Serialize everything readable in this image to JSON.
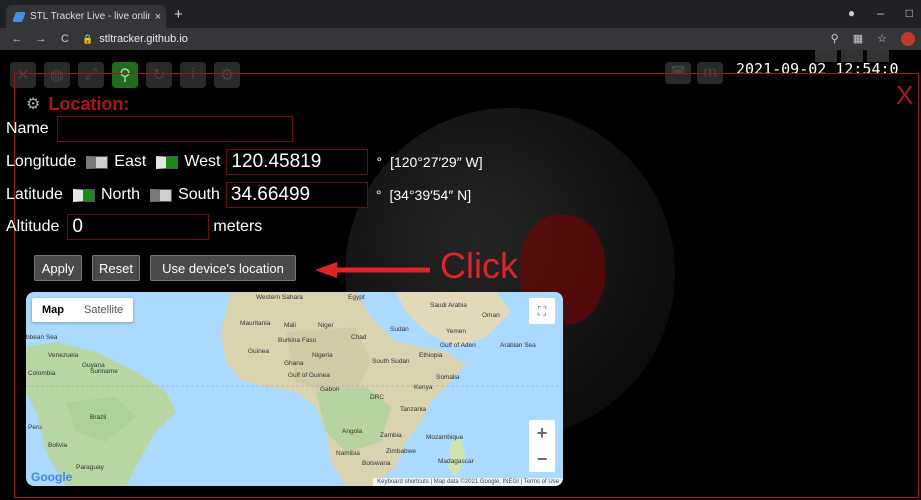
{
  "browser": {
    "tab_title": "STL Tracker Live - live online sate",
    "tab_close": "×",
    "new_tab": "+",
    "url": "stltracker.github.io",
    "minimize": "–",
    "maximize": "□"
  },
  "app": {
    "datetime": "2021-09-02 12:54:0",
    "close_label": "X",
    "toolbar_icons": [
      "satellite-icon",
      "globe-icon",
      "expand-icon",
      "location-icon",
      "refresh-icon",
      "info-icon",
      "settings-icon"
    ],
    "active_tool": "location-icon"
  },
  "location": {
    "title": "Location:",
    "name_label": "Name",
    "name_value": "",
    "longitude_label": "Longitude",
    "east_label": "East",
    "west_label": "West",
    "longitude_value": "120.45819",
    "longitude_degree": "°",
    "longitude_dms": "[120°27′29″ W]",
    "latitude_label": "Latitude",
    "north_label": "North",
    "south_label": "South",
    "latitude_value": "34.66499",
    "latitude_degree": "°",
    "latitude_dms": "[34°39′54″ N]",
    "altitude_label": "Altitude",
    "altitude_value": "0",
    "altitude_unit": "meters",
    "apply_label": "Apply",
    "reset_label": "Reset",
    "device_label": "Use device's location"
  },
  "annotation": {
    "click_text": "Click",
    "color": "#e02424"
  },
  "map": {
    "type_map": "Map",
    "type_satellite": "Satellite",
    "zoom_in": "+",
    "zoom_out": "−",
    "logo": "Google",
    "attribution": "Keyboard shortcuts | Map data ©2021 Google, INEGI | Terms of Use",
    "labels": {
      "western_sahara": "Western Sahara",
      "mauritania": "Mauritania",
      "mali": "Mali",
      "niger": "Niger",
      "chad": "Chad",
      "sudan": "Sudan",
      "egypt": "Egypt",
      "saudi": "Saudi Arabia",
      "oman": "Oman",
      "yemen": "Yemen",
      "burkina": "Burkina Faso",
      "guinea": "Guinea",
      "ghana": "Ghana",
      "nigeria": "Nigeria",
      "south_sudan": "South Sudan",
      "ethiopia": "Ethiopia",
      "somalia": "Somalia",
      "kenya": "Kenya",
      "gabon": "Gabon",
      "drc": "DRC",
      "tanzania": "Tanzania",
      "angola": "Angola",
      "zambia": "Zambia",
      "mozambique": "Mozambique",
      "namibia": "Namibia",
      "zimbabwe": "Zimbabwe",
      "botswana": "Botswana",
      "madagascar": "Madagascar",
      "venezuela": "Venezuela",
      "guyana": "Guyana",
      "suriname": "Suriname",
      "colombia": "Colombia",
      "brazil": "Brazil",
      "peru": "Peru",
      "bolivia": "Bolivia",
      "paraguay": "Paraguay",
      "gulf_guinea": "Gulf of Guinea",
      "gulf_aden": "Gulf of Aden",
      "arabian_sea": "Arabian Sea",
      "caribbean": "bbean Sea"
    }
  }
}
